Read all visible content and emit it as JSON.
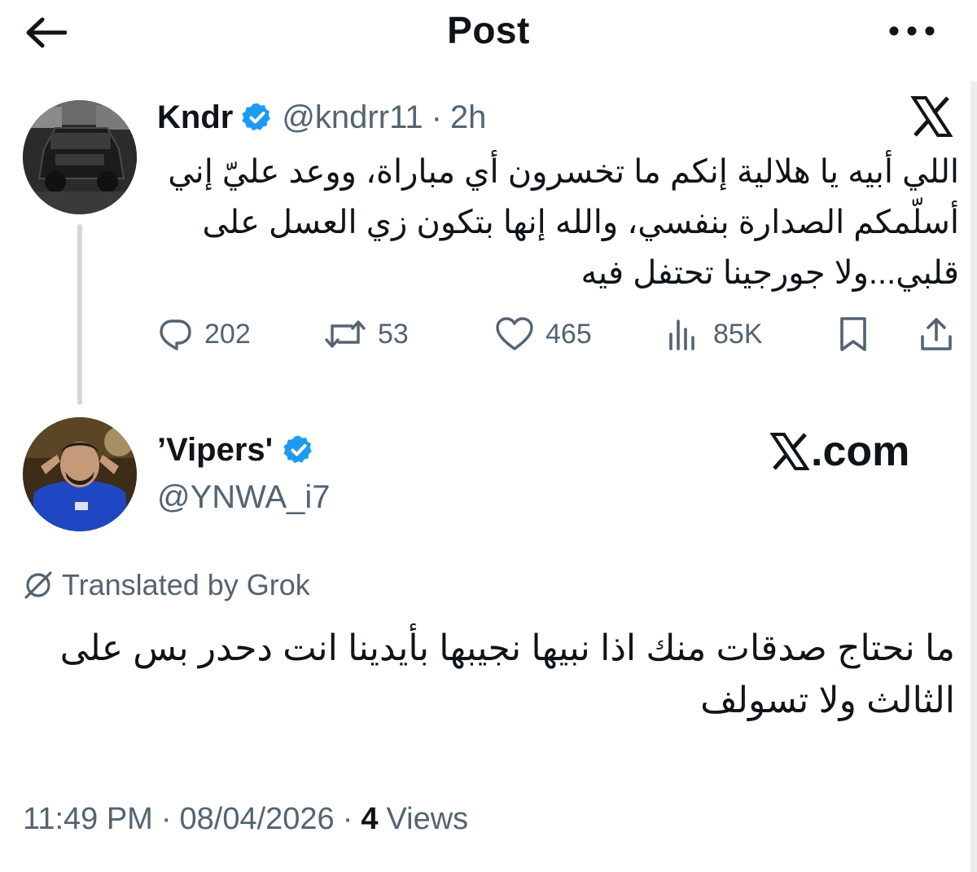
{
  "header": {
    "title": "Post"
  },
  "quoted_tweet": {
    "name": "Kndr",
    "handle": "@kndrr11",
    "separator": "·",
    "time": "2h",
    "text": "اللي أبيه يا هلالية إنكم ما تخسرون أي مباراة، ووعد عليّ إني أسلّمكم الصدارة بنفسي، والله إنها بتكون زي العسل على قلبي...ولا جورجينا تحتفل فيه",
    "stats": {
      "replies": "202",
      "reposts": "53",
      "likes": "465",
      "views": "85K"
    }
  },
  "reply": {
    "name": "’Vipers'",
    "handle": "@YNWA_i7",
    "watermark": ".com",
    "translated_label": "Translated by Grok",
    "text": "ما نحتاج صدقات منك اذا نبيها نجيبها بأيدينا  انت دحدر بس على الثالث ولا تسولف",
    "time": "11:49 PM",
    "date": "08/04/2026",
    "separator": "·",
    "views_count": "4",
    "views_label": "Views"
  },
  "colors": {
    "verified": "#1d9bf0",
    "secondary_text": "#536471",
    "primary_text": "#0f1419",
    "thread_line": "#cfd9de"
  }
}
